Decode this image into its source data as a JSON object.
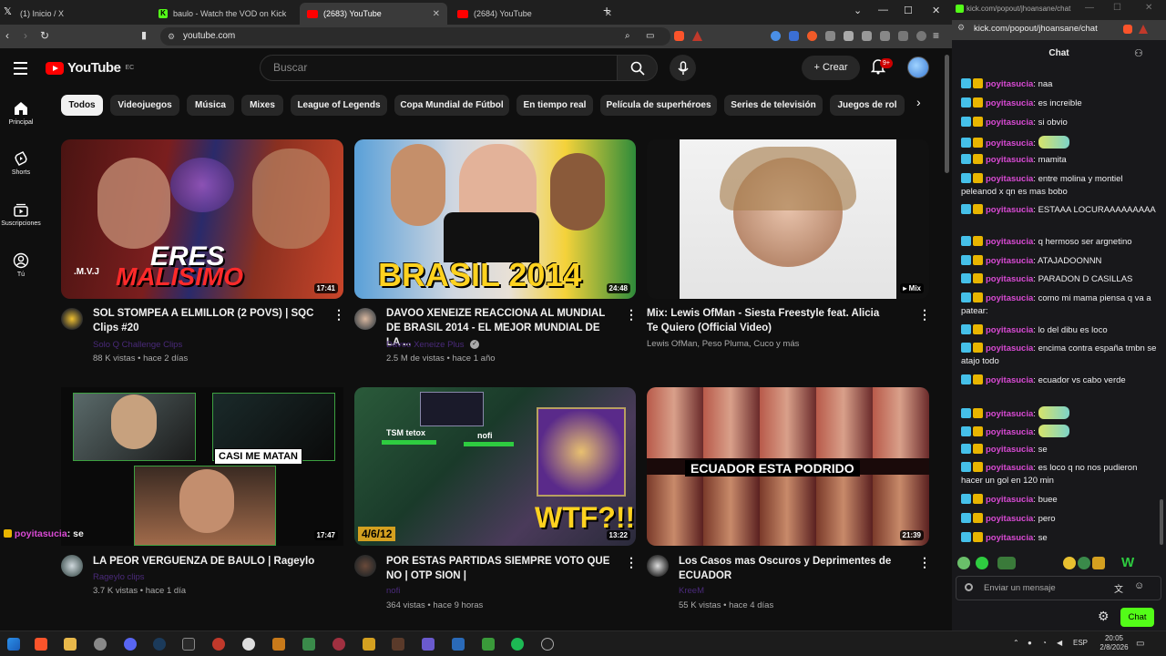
{
  "browser": {
    "tabs": [
      {
        "label": "(1) Inicio / X"
      },
      {
        "label": "baulo - Watch the VOD on Kick"
      },
      {
        "label": "(2683) YouTube"
      },
      {
        "label": "(2684) YouTube"
      }
    ],
    "url": "youtube.com"
  },
  "youtube": {
    "logo_text": "YouTube",
    "logo_region": "EC",
    "search_placeholder": "Buscar",
    "create_label": "Crear",
    "notif_count": "9+",
    "sidebar": [
      {
        "label": "Principal",
        "icon": "home-icon"
      },
      {
        "label": "Shorts",
        "icon": "shorts-icon"
      },
      {
        "label": "Suscripciones",
        "icon": "subscriptions-icon"
      },
      {
        "label": "Tú",
        "icon": "you-icon"
      }
    ],
    "chips": [
      "Todos",
      "Videojuegos",
      "Música",
      "Mixes",
      "League of Legends",
      "Copa Mundial de Fútbol",
      "En tiempo real",
      "Película de superhéroes",
      "Series de televisión",
      "Juegos de rol"
    ],
    "videos": [
      {
        "title": "SOL STOMPEA A ELMILLOR (2 POVS) | SQC Clips #20",
        "channel": "Solo Q Challenge Clips",
        "meta": "88 K vistas • hace 2 días",
        "duration": "17:41",
        "thumb_text": "ERES MALISIMO"
      },
      {
        "title": "DAVOO XENEIZE REACCIONA AL MUNDIAL DE BRASIL 2014 - EL MEJOR MUNDIAL DE LA ...",
        "channel": "Davoo Xeneize Plus",
        "meta": "2.5 M de vistas • hace 1 año",
        "duration": "24:48",
        "thumb_text": "BRASIL 2014"
      },
      {
        "title": "Mix: Lewis OfMan - Siesta Freestyle feat. Alicia Te Quiero (Official Video)",
        "channel": "Lewis OfMan, Peso Pluma, Cuco y más",
        "meta": "",
        "duration": "Mix",
        "thumb_text": ""
      },
      {
        "title": "LA PEOR VERGUENZA DE BAULO | Rageylo",
        "channel": "Rageylo clips",
        "meta": "3.7 K vistas • hace 1 día",
        "duration": "17:47",
        "thumb_text": "CASI ME MATAN"
      },
      {
        "title": "POR ESTAS PARTIDAS SIEMPRE VOTO QUE NO | OTP SION |",
        "channel": "nofi",
        "meta": "364 vistas • hace 9 horas",
        "duration": "13:22",
        "thumb_text": "WTF?!!"
      },
      {
        "title": "Los Casos mas Oscuros y Deprimentes de ECUADOR",
        "channel": "KreeM",
        "meta": "55 K vistas • hace 4 días",
        "duration": "21:39",
        "thumb_text": "ECUADOR ESTA PODRIDO"
      }
    ],
    "thumb_extras": {
      "mvj": ".M.V.J",
      "tsm": "TSM tetox",
      "nofi": "nofi",
      "kda": "4/6/12"
    }
  },
  "chat": {
    "url": "kick.com/popout/jhoansane/chat",
    "title": "Chat",
    "username": "poyitasucia",
    "messages": [
      {
        "text": "naa"
      },
      {
        "text": "es increible"
      },
      {
        "text": "si obvio"
      },
      {
        "text": "",
        "emote": true
      },
      {
        "text": "mamita"
      },
      {
        "text": "entre molina y montiel peleanod x qn es mas bobo"
      },
      {
        "text": "ESTAAA LOCURAAAAAAAAA"
      },
      {
        "text": "q hermoso ser argnetino"
      },
      {
        "text": "ATAJADOONNN"
      },
      {
        "text": "PARADON D CASILLAS"
      },
      {
        "text": "como mi mama piensa q va a patear:"
      },
      {
        "text": "lo del dibu es loco"
      },
      {
        "text": "encima contra españa tmbn se atajo todo"
      },
      {
        "text": "ecuador vs cabo verde"
      },
      {
        "text": "",
        "emote": true
      },
      {
        "text": "",
        "emote": true
      },
      {
        "text": "se"
      },
      {
        "text": "es loco q no nos pudieron hacer un gol en 120 min"
      },
      {
        "text": "buee"
      },
      {
        "text": "pero"
      },
      {
        "text": "se"
      }
    ],
    "input_placeholder": "Enviar un mensaje",
    "send_label": "Chat",
    "floating_user": "poyitasucia",
    "floating_text": "se"
  },
  "taskbar": {
    "lang": "ESP",
    "time": "20:05",
    "date": "2/8/2026"
  },
  "colors": {
    "yt_bg": "#0f0f0f",
    "kick_green": "#53fc18",
    "username": "#d94ad4",
    "yt_red": "#ff0000"
  }
}
